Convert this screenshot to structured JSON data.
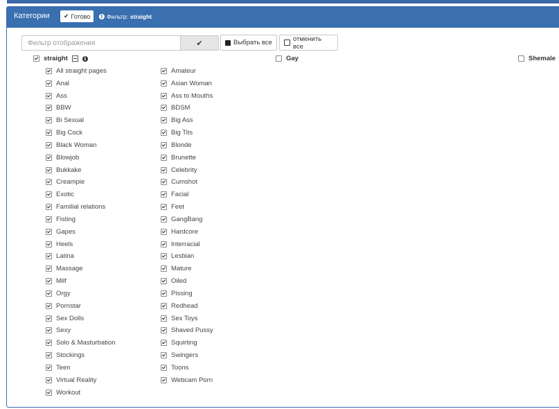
{
  "header": {
    "title": "Категории",
    "done_label": "Готово",
    "filter_prefix": "Фильтр:",
    "filter_value": "straight"
  },
  "search": {
    "placeholder": "Фильтр отображения",
    "value": ""
  },
  "buttons": {
    "select_all": "Выбрать все",
    "deselect_all": "отменить все"
  },
  "groups": [
    {
      "label": "straight",
      "checked": true,
      "expanded": true
    },
    {
      "label": "Gay",
      "checked": false,
      "expanded": false
    },
    {
      "label": "Shemale",
      "checked": false,
      "expanded": false
    }
  ],
  "straight_col1": [
    "All straight pages",
    "Anal",
    "Ass",
    "BBW",
    "Bi Sexual",
    "Big Cock",
    "Black Woman",
    "Blowjob",
    "Bukkake",
    "Creampie",
    "Exotic",
    "Familial relations",
    "Fisting",
    "Gapes",
    "Heels",
    "Latina",
    "Massage",
    "Milf",
    "Orgy",
    "Pornstar",
    "Sex Dolls",
    "Sexy",
    "Solo & Masturbation",
    "Stockings",
    "Teen",
    "Virtual Reality",
    "Workout"
  ],
  "straight_col2": [
    "Amateur",
    "Asian Woman",
    "Ass to Mouths",
    "BDSM",
    "Big Ass",
    "Big Tits",
    "Blonde",
    "Brunette",
    "Celebrity",
    "Cumshot",
    "Facial",
    "Feet",
    "GangBang",
    "Hardcore",
    "Interracial",
    "Lesbian",
    "Mature",
    "Oiled",
    "Pissing",
    "Redhead",
    "Sex Toys",
    "Shaved Pussy",
    "Squirting",
    "Swingers",
    "Toons",
    "Webcam Porn"
  ],
  "colors": {
    "header_bg": "#3a6fb0",
    "border": "#3a69a8"
  },
  "icons": {
    "done": "check-icon",
    "filter_info": "info-icon",
    "search_ok": "check-icon",
    "select_all": "filled-square-icon",
    "deselect_all": "empty-square-icon"
  }
}
